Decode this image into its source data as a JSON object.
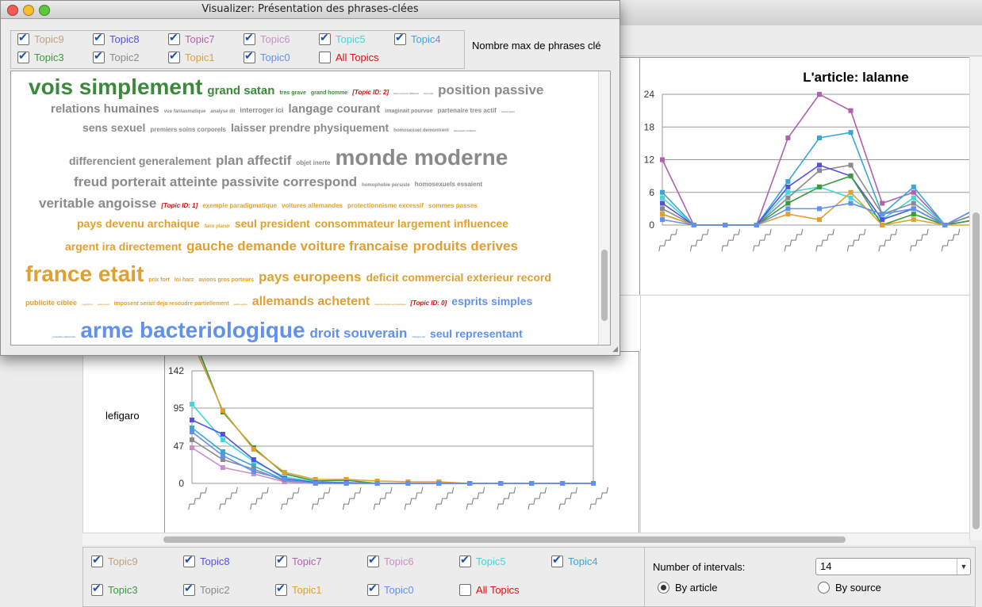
{
  "topics": [
    {
      "label": "Topic9",
      "color": "#c0a080",
      "checked": true
    },
    {
      "label": "Topic8",
      "color": "#5252e0",
      "checked": true
    },
    {
      "label": "Topic7",
      "color": "#b060b0",
      "checked": true
    },
    {
      "label": "Topic6",
      "color": "#c890c8",
      "checked": true
    },
    {
      "label": "Topic5",
      "color": "#40d8d8",
      "checked": true
    },
    {
      "label": "Topic4",
      "color": "#3aa6d6",
      "checked": true
    },
    {
      "label": "Topic3",
      "color": "#3a9a3a",
      "checked": true
    },
    {
      "label": "Topic2",
      "color": "#8a8a8a",
      "checked": true
    },
    {
      "label": "Topic1",
      "color": "#e0a030",
      "checked": true
    },
    {
      "label": "Topic0",
      "color": "#6090f0",
      "checked": true
    },
    {
      "label": "All Topics",
      "color": "#e01010",
      "checked": false
    }
  ],
  "front": {
    "title": "Visualizer: Présentation des phrases-clées",
    "max_phrases_label": "Nombre max de phrases clé"
  },
  "cloud": [
    [
      {
        "t": "vois simplement",
        "s": 28,
        "c": "#3a8a3a"
      },
      {
        "t": "grand satan",
        "s": 15,
        "c": "#3a8a3a"
      },
      {
        "t": "tres grave",
        "s": 7,
        "c": "#3a8a3a"
      },
      {
        "t": "grand homme",
        "s": 7,
        "c": "#3a8a3a"
      },
      {
        "t": "[Topic ID: 2]",
        "s": 8,
        "c": "#d01010",
        "i": true
      },
      {
        "t": "faire recevoir different",
        "s": 3,
        "c": "#888"
      },
      {
        "t": "tout cela",
        "s": 3,
        "c": "#888"
      },
      {
        "t": "position passive",
        "s": 17,
        "c": "#8a8a8a"
      }
    ],
    [
      {
        "t": "relations humaines",
        "s": 15,
        "c": "#8a8a8a"
      },
      {
        "t": "vue fantasmatique",
        "s": 6,
        "c": "#8a8a8a"
      },
      {
        "t": "analyse dit",
        "s": 6,
        "c": "#8a8a8a"
      },
      {
        "t": "interroger ici",
        "s": 9,
        "c": "#8a8a8a"
      },
      {
        "t": "langage courant",
        "s": 15,
        "c": "#8a8a8a"
      },
      {
        "t": "imaginait pourvue",
        "s": 7,
        "c": "#8a8a8a"
      },
      {
        "t": "partenaire tres actif",
        "s": 8,
        "c": "#8a8a8a"
      },
      {
        "t": "mentir juste",
        "s": 3,
        "c": "#8a8a8a"
      }
    ],
    [
      {
        "t": "sens sexuel",
        "s": 14,
        "c": "#8a8a8a"
      },
      {
        "t": "premiers soins corporels",
        "s": 8,
        "c": "#8a8a8a"
      },
      {
        "t": "laisser prendre physiquement",
        "s": 14,
        "c": "#8a8a8a"
      },
      {
        "t": "homosexuel demontrent",
        "s": 6,
        "c": "#8a8a8a"
      },
      {
        "t": "autrement multiples",
        "s": 3,
        "c": "#8a8a8a"
      }
    ],
    [
      {
        "t": "differencient generalement",
        "s": 14,
        "c": "#8a8a8a"
      },
      {
        "t": "plan affectif",
        "s": 17,
        "c": "#8a8a8a"
      },
      {
        "t": "objet inerte",
        "s": 8,
        "c": "#8a8a8a"
      },
      {
        "t": "monde moderne",
        "s": 28,
        "c": "#8a8a8a"
      }
    ],
    [
      {
        "t": "freud porterait atteinte passivite correspond",
        "s": 17,
        "c": "#8a8a8a"
      },
      {
        "t": "homophobie persiste",
        "s": 6,
        "c": "#8a8a8a"
      },
      {
        "t": "homosexuels essaient",
        "s": 8,
        "c": "#8a8a8a"
      }
    ],
    [
      {
        "t": "veritable angoisse",
        "s": 17,
        "c": "#8a8a8a"
      },
      {
        "t": "[Topic ID: 1]",
        "s": 8,
        "c": "#d01010",
        "i": true
      },
      {
        "t": "exemple paradigmatique",
        "s": 8,
        "c": "#e0a030"
      },
      {
        "t": "voitures allemandes",
        "s": 8,
        "c": "#e0a030"
      },
      {
        "t": "protectionnisme excessif",
        "s": 8,
        "c": "#e0a030"
      },
      {
        "t": "sommes passes",
        "s": 8,
        "c": "#e0a030"
      }
    ],
    [
      {
        "t": "pays devenu archaique",
        "s": 14,
        "c": "#e0a030"
      },
      {
        "t": "faire plaisir",
        "s": 6,
        "c": "#e0a030"
      },
      {
        "t": "seul president",
        "s": 14,
        "c": "#e0a030"
      },
      {
        "t": "consommateur largement influencee",
        "s": 14,
        "c": "#e0a030"
      }
    ],
    [
      {
        "t": "argent ira directement",
        "s": 14,
        "c": "#e0a030"
      },
      {
        "t": "gauche demande voiture francaise",
        "s": 17,
        "c": "#e0a030"
      },
      {
        "t": "produits derives",
        "s": 17,
        "c": "#e0a030"
      }
    ],
    [
      {
        "t": "france etait",
        "s": 28,
        "c": "#e0a030"
      },
      {
        "t": "prix fort",
        "s": 7,
        "c": "#e0a030"
      },
      {
        "t": "loi harz",
        "s": 7,
        "c": "#e0a030"
      },
      {
        "t": "avions gros porteurs",
        "s": 7,
        "c": "#e0a030"
      },
      {
        "t": "pays europeens",
        "s": 17,
        "c": "#e0a030"
      },
      {
        "t": "deficit commercial exterieur record",
        "s": 14,
        "c": "#e0a030"
      }
    ],
    [
      {
        "t": "publicite ciblee",
        "s": 9,
        "c": "#e0a030"
      },
      {
        "t": "si grain le",
        "s": 3,
        "c": "#e0a030"
      },
      {
        "t": "aussi seul",
        "s": 3,
        "c": "#e0a030"
      },
      {
        "t": "imposent serait deja resoudre partiellement",
        "s": 7,
        "c": "#e0a030"
      },
      {
        "t": "petite partie",
        "s": 3,
        "c": "#e0a030"
      },
      {
        "t": "allemands achetent",
        "s": 16,
        "c": "#e0a030"
      },
      {
        "t": "roberte mance economique",
        "s": 3,
        "c": "#e0a030"
      },
      {
        "t": "[Topic ID: 0]",
        "s": 8,
        "c": "#d01010",
        "i": true
      },
      {
        "t": "esprits simples",
        "s": 14,
        "c": "#6090f0"
      }
    ],
    [
      {
        "t": "connaitre clairement",
        "s": 3,
        "c": "#6090f0"
      },
      {
        "t": "arme bacteriologique",
        "s": 28,
        "c": "#6090f0"
      },
      {
        "t": "droit souverain",
        "s": 17,
        "c": "#6090f0"
      },
      {
        "t": "changer vie",
        "s": 3,
        "c": "#6090f0"
      },
      {
        "t": "seul representant",
        "s": 14,
        "c": "#6090f0"
      }
    ]
  ],
  "right_chart": {
    "title": "L'article: lalanne",
    "yticks": [
      "24",
      "18",
      "12",
      "6",
      "0"
    ]
  },
  "chart_data": [
    {
      "type": "line",
      "title": "L'article: lalanne",
      "ylim": [
        0,
        24
      ],
      "yticks": [
        0,
        6,
        12,
        18,
        24
      ],
      "series": [
        {
          "color": "#b060b0",
          "values": [
            12,
            0,
            0,
            0,
            16,
            24,
            21,
            4,
            6,
            0,
            2
          ]
        },
        {
          "color": "#3aa6d6",
          "values": [
            6,
            0,
            0,
            0,
            8,
            16,
            17,
            2,
            7,
            0,
            3
          ]
        },
        {
          "color": "#40d8d8",
          "values": [
            5,
            0,
            0,
            0,
            6,
            7,
            5,
            1,
            5,
            0,
            2
          ]
        },
        {
          "color": "#8a8a8a",
          "values": [
            3,
            0,
            0,
            0,
            5,
            10,
            11,
            2,
            4,
            0,
            2
          ]
        },
        {
          "color": "#5252e0",
          "values": [
            4,
            0,
            0,
            0,
            7,
            11,
            9,
            1,
            3,
            0,
            1
          ]
        },
        {
          "color": "#3a9a3a",
          "values": [
            2,
            0,
            0,
            0,
            4,
            7,
            9,
            0,
            2,
            0,
            1
          ]
        },
        {
          "color": "#e0a030",
          "values": [
            2,
            0,
            0,
            0,
            2,
            1,
            6,
            0,
            1,
            0,
            0
          ]
        },
        {
          "color": "#6090f0",
          "values": [
            1,
            0,
            0,
            0,
            3,
            3,
            4,
            2,
            3,
            0,
            3
          ]
        }
      ]
    },
    {
      "type": "line",
      "title": "lefigaro",
      "ylim": [
        0,
        142
      ],
      "yticks": [
        0,
        47,
        95,
        142
      ],
      "series": [
        {
          "color": "#3a9a3a",
          "values": [
            190,
            90,
            45,
            12,
            3,
            4,
            0,
            0,
            0,
            0,
            0,
            0,
            0,
            0
          ]
        },
        {
          "color": "#e0a030",
          "values": [
            180,
            92,
            43,
            14,
            5,
            5,
            3,
            2,
            2,
            0,
            0,
            0,
            0,
            0
          ]
        },
        {
          "color": "#40d8d8",
          "values": [
            100,
            55,
            28,
            8,
            2,
            1,
            0,
            0,
            0,
            0,
            0,
            0,
            0,
            0
          ]
        },
        {
          "color": "#5252e0",
          "values": [
            80,
            62,
            30,
            6,
            1,
            1,
            0,
            0,
            0,
            0,
            0,
            0,
            0,
            0
          ]
        },
        {
          "color": "#3aa6d6",
          "values": [
            70,
            40,
            22,
            4,
            0,
            0,
            0,
            0,
            0,
            0,
            0,
            0,
            0,
            0
          ]
        },
        {
          "color": "#8a8a8a",
          "values": [
            55,
            30,
            18,
            3,
            0,
            0,
            0,
            0,
            0,
            0,
            0,
            0,
            0,
            0
          ]
        },
        {
          "color": "#c890c8",
          "values": [
            45,
            20,
            12,
            2,
            0,
            0,
            0,
            0,
            0,
            0,
            0,
            0,
            0,
            0
          ]
        },
        {
          "color": "#6090f0",
          "values": [
            65,
            35,
            15,
            5,
            0,
            0,
            0,
            0,
            0,
            0,
            0,
            0,
            0,
            0
          ]
        }
      ]
    }
  ],
  "left_chart": {
    "source_label": "lefigaro",
    "yticks": [
      "142",
      "95",
      "47",
      "0"
    ]
  },
  "bottom": {
    "intervals_label": "Number of intervals:",
    "intervals_value": "14",
    "by_article": "By article",
    "by_source": "By source"
  }
}
